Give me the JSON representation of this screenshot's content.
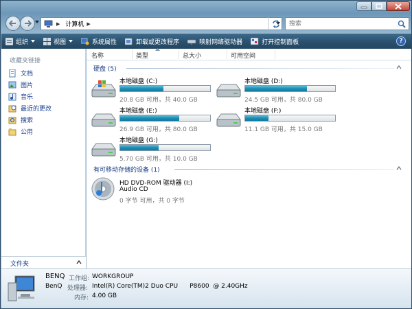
{
  "address": {
    "crumbs": [
      "计算机"
    ]
  },
  "search": {
    "placeholder": "搜索"
  },
  "toolbar": {
    "organize": "组织",
    "views": "视图",
    "system_properties": "系统属性",
    "uninstall": "卸载或更改程序",
    "map_drive": "映射网络驱动器",
    "control_panel": "打开控制面板"
  },
  "nav": {
    "favorites_title": "收藏夹链接",
    "items": [
      {
        "label": "文档",
        "icon": "documents-icon"
      },
      {
        "label": "图片",
        "icon": "pictures-icon"
      },
      {
        "label": "音乐",
        "icon": "music-icon"
      },
      {
        "label": "最近的更改",
        "icon": "recent-changes-icon"
      },
      {
        "label": "搜索",
        "icon": "searches-icon"
      },
      {
        "label": "公用",
        "icon": "public-icon"
      }
    ],
    "folders_label": "文件夹"
  },
  "columns": {
    "name": "名称",
    "type": "类型",
    "total_size": "总大小",
    "free_space": "可用空间"
  },
  "groups": {
    "hard_disks": "硬盘 (5)",
    "removable": "有可移动存储的设备 (1)"
  },
  "drives": [
    {
      "name": "本地磁盘 (C:)",
      "info": "20.8 GB 可用，共 40.0 GB",
      "used_fraction": 0.48
    },
    {
      "name": "本地磁盘 (D:)",
      "info": "24.5 GB 可用，共 80.0 GB",
      "used_fraction": 0.69
    },
    {
      "name": "本地磁盘 (E:)",
      "info": "26.9 GB 可用，共 80.0 GB",
      "used_fraction": 0.66
    },
    {
      "name": "本地磁盘 (F:)",
      "info": "11.1 GB 可用，共 15.0 GB",
      "used_fraction": 0.26
    },
    {
      "name": "本地磁盘 (G:)",
      "info": "5.70 GB 可用，共 10.0 GB",
      "used_fraction": 0.43
    }
  ],
  "dvd": {
    "name": "HD DVD-ROM 驱动器 (I:)",
    "label": "Audio CD",
    "info": "0 字节 可用，共 0 字节"
  },
  "details": {
    "computer_name": "BENQ",
    "workgroup_key": "工作组:",
    "workgroup_val": "WORKGROUP",
    "model": "BenQ",
    "cpu_key": "处理器:",
    "cpu_val": "Intel(R) Core(TM)2 Duo CPU      P8600  @ 2.40GHz",
    "memory_key": "内存:",
    "memory_val": "4.00 GB"
  },
  "colors": {
    "drive_fill": "#1e8db4",
    "link": "#1b3f8f",
    "toolbar": "#2a506e"
  }
}
